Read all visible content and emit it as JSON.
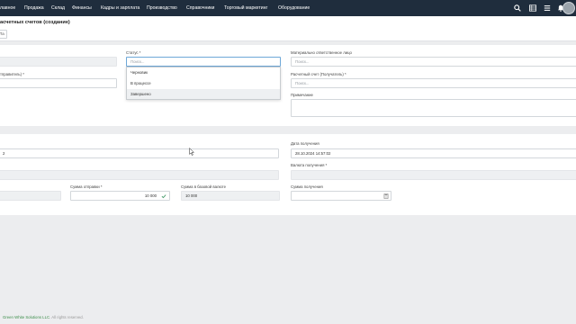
{
  "nav": {
    "items": [
      "лавное",
      "Продажа",
      "Склад",
      "Финансы",
      "Кадры и зарплата",
      "Производство",
      "Справочники",
      "Торговый маркетинг",
      "Оборудование"
    ],
    "icons": [
      "search-icon",
      "grid-icon",
      "list-icon",
      "bell-icon"
    ]
  },
  "header": {
    "title": "асчетных счетов (создание)",
    "button_label": "Па"
  },
  "form": {
    "status_label": "Статус *",
    "status_placeholder": "Поиск...",
    "status_options": [
      "Черновик",
      "В процессе",
      "Завершено"
    ],
    "responsible_label": "Материально ответственное лицо",
    "responsible_placeholder": "Поиск...",
    "sender_label": "тправитель) *",
    "receiver_account_label": "Расчетный счет (Получатель) *",
    "receiver_account_placeholder": "Поиск...",
    "note_label": "Примечание",
    "send_date_value": "2",
    "receive_date_label": "Дата получения",
    "receive_date_value": "28.10.2024 14:57:02",
    "receive_currency_label": "Валюта получения *",
    "send_amount_label": "Сумма отправки *",
    "send_amount_value": "10 000",
    "base_amount_label": "Сумма в базовой валюте",
    "base_amount_value": "10 000",
    "receive_amount_label": "Сумма получения"
  },
  "footer": {
    "brand": "Green White Solutions LLC",
    "rest": ". All rights reserved."
  }
}
